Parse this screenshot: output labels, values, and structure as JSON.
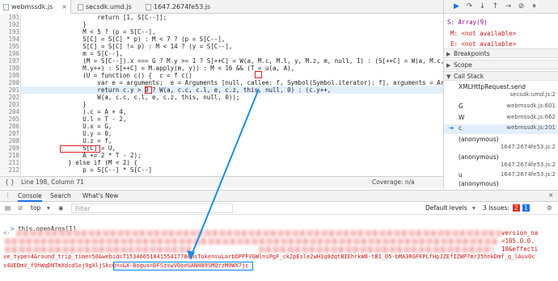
{
  "tabs": [
    {
      "label": "webmssdk.js",
      "active": true
    },
    {
      "label": "secsdk.umd.js",
      "active": false
    },
    {
      "label": "1647.2674fe53.js",
      "active": false
    }
  ],
  "editor": {
    "lines": [
      {
        "n": "191",
        "text": "                    return [1, S[C--]];"
      },
      {
        "n": "192",
        "text": "                }"
      },
      {
        "n": "193",
        "text": "                M < 5 ? (p = S[C--],"
      },
      {
        "n": "194",
        "text": "                S[C] = S[C] * p) : M < 7 ? (p = S[C--],"
      },
      {
        "n": "195",
        "text": "                S[C] = S[C] != p) : M < 14 ? (y = S[C--],"
      },
      {
        "n": "196",
        "text": "                m = S[C--],"
      },
      {
        "n": "197",
        "text": "                (M = S[C--]).x === G ? M.y >= 1 ? S[++C] = W(a, M.c, M.l, y, M.z, m, null, 1) : (S[++C] = W(a, M.c, M.l, y, M.z, m, null, 0),"
      },
      {
        "n": "198",
        "text": "                M.y++) : S[++C] = M.apply(m, y)) : M < 16 && (T = u(a, A),"
      },
      {
        "n": "199",
        "text": "                (U = function c() {  c = f c()"
      },
      {
        "n": "200",
        "text": "                    var e = arguments;  e = Arguments [null, callee: f, Symbol(Symbol.iterator): f], arguments = Argu"
      },
      {
        "n": "201",
        "text": "                    return c.y > 0 ? W(a, c.c, c.l, e, c.z, this, null, 0) : (c.y++,"
      },
      {
        "n": "202",
        "text": "                    W(a, c.c, c.l, e, c.z, this, null, 0));"
      },
      {
        "n": "203",
        "text": "                }"
      },
      {
        "n": "204",
        "text": "                ).c = A + 4,"
      },
      {
        "n": "205",
        "text": "                U.l = T - 2,"
      },
      {
        "n": "206",
        "text": "                U.x = G,"
      },
      {
        "n": "207",
        "text": "                U.y = 0,"
      },
      {
        "n": "208",
        "text": "                U.z = f,"
      },
      {
        "n": "209",
        "text": "                S[C] = U,"
      },
      {
        "n": "210",
        "text": "                A += 2 * T - 2);"
      },
      {
        "n": "211",
        "text": "            } else if (M < 2) {"
      },
      {
        "n": "212",
        "text": "                p = S[C--] * S[C--]"
      }
    ]
  },
  "status": {
    "position": "Line 198, Column 71",
    "coverage": "Coverage: n/a"
  },
  "debugger": {
    "scope_lines": [
      {
        "label": "S: Array(9)",
        "color": "#881280"
      },
      {
        "label": "M: <not available>",
        "color": "#c41a16"
      },
      {
        "label": "E: <not available>",
        "color": "#c41a16"
      }
    ],
    "sections": {
      "breakpoints": "Breakpoints",
      "scope": "Scope",
      "callstack": "Call Stack"
    },
    "call_stack": [
      {
        "fn": "XMLHttpRequest.send",
        "loc": "secsdk.umd.js:2",
        "current": false
      },
      {
        "fn": "G",
        "loc": "webmssdk.js:601",
        "current": false
      },
      {
        "fn": "W",
        "loc": "webmssdk.js:662",
        "current": false
      },
      {
        "fn": "c",
        "loc": "webmssdk.js:201",
        "current": true
      },
      {
        "fn": "(anonymous)",
        "loc": "1647.2674fe53.js:2",
        "current": false
      },
      {
        "fn": "(anonymous)",
        "loc": "1647.2674fe53.js:2",
        "current": false
      },
      {
        "fn": "u",
        "loc": "1647.2674fe53.js:2",
        "current": false
      },
      {
        "fn": "(anonymous)",
        "loc": "1647.2674fe53.js:2",
        "current": false
      }
    ]
  },
  "drawer": {
    "tabs": [
      "Console",
      "Search",
      "What's New"
    ],
    "context": "top",
    "filter_placeholder": "Filter",
    "levels": "Default levels",
    "issues": "3 Issues:",
    "issues_red": "2",
    "issues_blue": "1"
  },
  "console": {
    "command": "this.openArgs[1]",
    "line3_visible": "ve_type=4&round_trip_time=50&webid=7153466518415541778&msToken=uLarbDPPFVGWlnsPgF_ck2pEsle2wH3q0dqtBIEhrkW8-tB1_O5-bMA3RGFKPLfHpJZEfIZWP7mrJ5hnkDmf_q_lAuv0c",
    "line4_visible": "s4UEDmV_f9hWqDNTmXdcdSoj9gXljSkcQ==&X-Bogus=DFSzswVOoeUANH89SMQrzM9WX7jc",
    "right1": "version_na",
    "right2": "=105.0.0.",
    "right3": "10&effecti"
  },
  "colors": {
    "accent": "#0a84ff",
    "highlight_red": "#e02020",
    "string_red": "#c41a16"
  }
}
